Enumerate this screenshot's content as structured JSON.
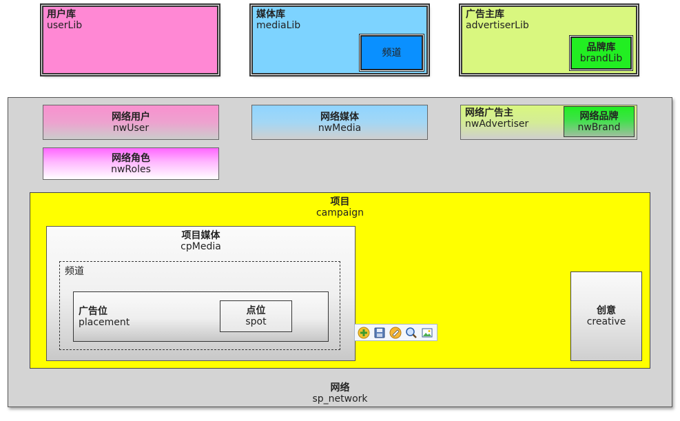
{
  "top": {
    "userLib": {
      "cn": "用户库",
      "en": "userLib",
      "color": "#ff88d4"
    },
    "mediaLib": {
      "cn": "媒体库",
      "en": "mediaLib",
      "color": "#7dd3ff",
      "channel": "频道",
      "channel_color": "#0a90ff"
    },
    "advertiserLib": {
      "cn": "广告主库",
      "en": "advertiserLib",
      "color": "#d9f77f",
      "brand_cn": "品牌库",
      "brand_en": "brandLib",
      "brand_color": "#22ee22"
    }
  },
  "network": {
    "label_cn": "网络",
    "label_en": "sp_network",
    "nwUser": {
      "cn": "网络用户",
      "en": "nwUser"
    },
    "nwRoles": {
      "cn": "网络角色",
      "en": "nwRoles"
    },
    "nwMedia": {
      "cn": "网络媒体",
      "en": "nwMedia"
    },
    "nwAdvertiser": {
      "cn": "网络广告主",
      "en": "nwAdvertiser"
    },
    "nwBrand": {
      "cn": "网络品牌",
      "en": "nwBrand"
    }
  },
  "campaign": {
    "cn": "项目",
    "en": "campaign",
    "cpMedia": {
      "cn": "项目媒体",
      "en": "cpMedia"
    },
    "channel": "频道",
    "placement": {
      "cn": "广告位",
      "en": "placement"
    },
    "spot": {
      "cn": "点位",
      "en": "spot"
    },
    "creative": {
      "cn": "创意",
      "en": "creative"
    }
  },
  "toolbar": {
    "icons": [
      "add-node-icon",
      "save-icon",
      "edit-icon",
      "search-icon",
      "export-image-icon"
    ]
  }
}
